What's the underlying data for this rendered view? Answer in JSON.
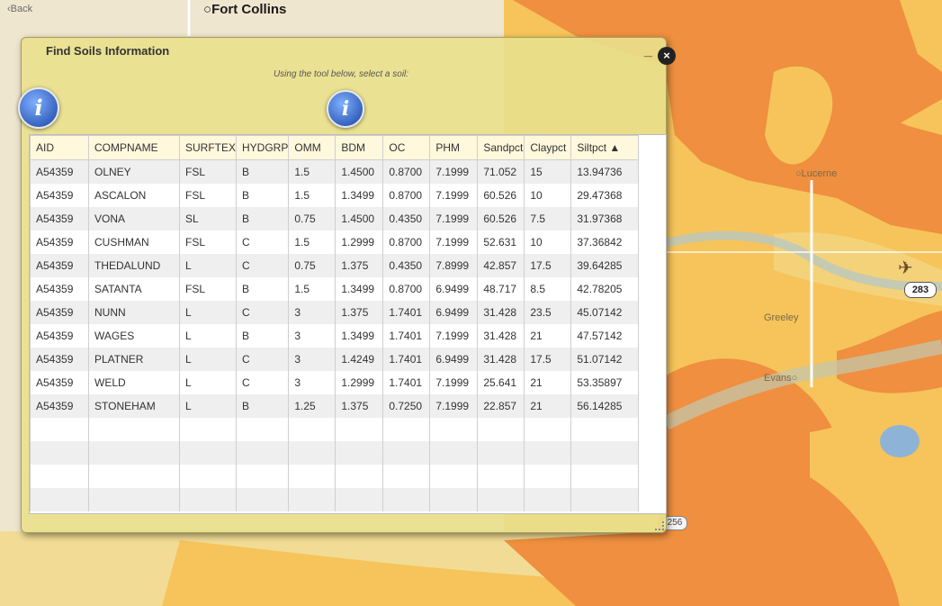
{
  "map": {
    "back_label": "Back",
    "city_fort_collins": "Fort Collins",
    "city_lucerne": "Lucerne",
    "city_greeley": "Greeley",
    "city_evans": "Evans",
    "highway_283": "283",
    "highway_256": "256",
    "colors": {
      "dark_orange": "#ef8f3f",
      "light_orange": "#f6c45a",
      "pale": "#f4e6c8",
      "basemap": "#e8e5de",
      "water": "#8db4d6"
    }
  },
  "dialog": {
    "title": "Find Soils Information",
    "minimize_label": "_",
    "close_label": "×",
    "instruction": "Using the tool below, select a soil:",
    "info_glyph": "i"
  },
  "table": {
    "headers": [
      "AID",
      "COMPNAME",
      "SURFTEX",
      "HYDGRP",
      "OMM",
      "BDM",
      "OC",
      "PHM",
      "Sandpct",
      "Claypct",
      "Siltpct ▲"
    ],
    "rows": [
      [
        "A54359",
        "OLNEY",
        "FSL",
        "B",
        "1.5",
        "1.4500",
        "0.8700",
        "7.1999",
        "71.052",
        "15",
        "13.94736"
      ],
      [
        "A54359",
        "ASCALON",
        "FSL",
        "B",
        "1.5",
        "1.3499",
        "0.8700",
        "7.1999",
        "60.526",
        "10",
        "29.47368"
      ],
      [
        "A54359",
        "VONA",
        "SL",
        "B",
        "0.75",
        "1.4500",
        "0.4350",
        "7.1999",
        "60.526",
        "7.5",
        "31.97368"
      ],
      [
        "A54359",
        "CUSHMAN",
        "FSL",
        "C",
        "1.5",
        "1.2999",
        "0.8700",
        "7.1999",
        "52.631",
        "10",
        "37.36842"
      ],
      [
        "A54359",
        "THEDALUND",
        "L",
        "C",
        "0.75",
        "1.375",
        "0.4350",
        "7.8999",
        "42.857",
        "17.5",
        "39.64285"
      ],
      [
        "A54359",
        "SATANTA",
        "FSL",
        "B",
        "1.5",
        "1.3499",
        "0.8700",
        "6.9499",
        "48.717",
        "8.5",
        "42.78205"
      ],
      [
        "A54359",
        "NUNN",
        "L",
        "C",
        "3",
        "1.375",
        "1.7401",
        "6.9499",
        "31.428",
        "23.5",
        "45.07142"
      ],
      [
        "A54359",
        "WAGES",
        "L",
        "B",
        "3",
        "1.3499",
        "1.7401",
        "7.1999",
        "31.428",
        "21",
        "47.57142"
      ],
      [
        "A54359",
        "PLATNER",
        "L",
        "C",
        "3",
        "1.4249",
        "1.7401",
        "6.9499",
        "31.428",
        "17.5",
        "51.07142"
      ],
      [
        "A54359",
        "WELD",
        "L",
        "C",
        "3",
        "1.2999",
        "1.7401",
        "7.1999",
        "25.641",
        "21",
        "53.35897"
      ],
      [
        "A54359",
        "STONEHAM",
        "L",
        "B",
        "1.25",
        "1.375",
        "0.7250",
        "7.1999",
        "22.857",
        "21",
        "56.14285"
      ]
    ],
    "empty_rows": 4
  }
}
